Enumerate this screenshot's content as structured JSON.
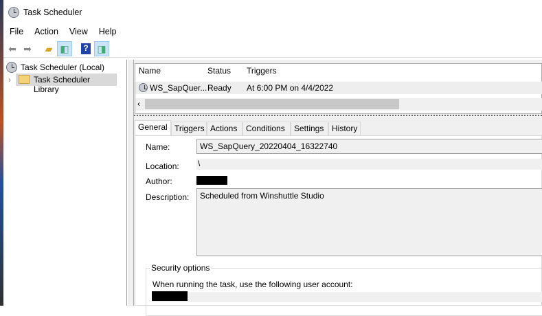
{
  "window": {
    "title": "Task Scheduler"
  },
  "menu": [
    "File",
    "Action",
    "View",
    "Help"
  ],
  "toolbar": {
    "icons": [
      "back-arrow-icon",
      "forward-arrow-icon",
      "up-folder-icon",
      "show-hide-console-tree-icon",
      "help-icon",
      "show-hide-action-pane-icon"
    ]
  },
  "tree": {
    "root": "Task Scheduler (Local)",
    "child": "Task Scheduler Library"
  },
  "list": {
    "columns": [
      "Name",
      "Status",
      "Triggers"
    ],
    "rows": [
      {
        "name": "WS_SapQuer...",
        "status": "Ready",
        "triggers": "At 6:00 PM on 4/4/2022"
      }
    ]
  },
  "tabs": [
    "General",
    "Triggers",
    "Actions",
    "Conditions",
    "Settings",
    "History"
  ],
  "general": {
    "name_label": "Name:",
    "name_value": "WS_SapQuery_20220404_16322740",
    "location_label": "Location:",
    "location_value": "\\",
    "author_label": "Author:",
    "description_label": "Description:",
    "description_value": "Scheduled from Winshuttle Studio",
    "security_title": "Security options",
    "security_text": "When running the task, use the following user account:"
  }
}
